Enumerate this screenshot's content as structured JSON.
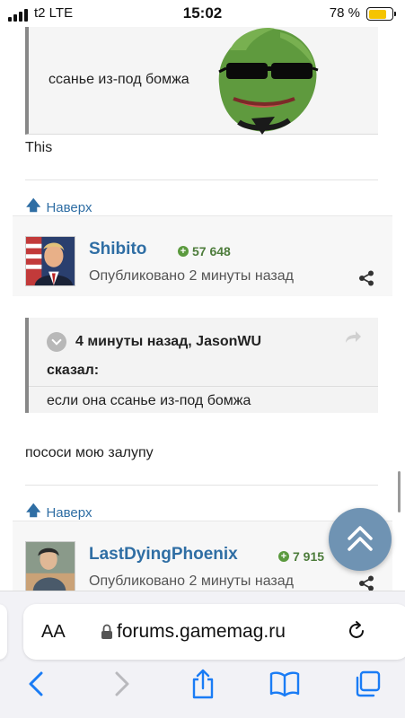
{
  "status_bar": {
    "carrier": "t2  LTE",
    "time": "15:02",
    "battery_percent": "78 %",
    "battery_level": 0.78
  },
  "posts": [
    {
      "quote_text": "ссанье из-под бомжа",
      "reply_text": "This",
      "to_top": "Наверх"
    },
    {
      "username": "Shibito",
      "reputation": "57 648",
      "published": "Опубликовано 2 минуты назад",
      "quote_header": "4 минуты назад, JasonWU",
      "quote_said": "сказал:",
      "quote_body": "если она ссанье из-под бомжа",
      "reply_text": "пососи мою залупу",
      "to_top": "Наверх"
    },
    {
      "username": "LastDyingPhoenix",
      "reputation": "7 915",
      "published": "Опубликовано 2 минуты назад"
    }
  ],
  "browser": {
    "aa_label": "AA",
    "url": "forums.gamemag.ru"
  },
  "icons": {
    "share": "share-icon",
    "scroll_top": "double-chevron-up-icon",
    "back": "chevron-left-icon",
    "forward": "chevron-right-icon",
    "share_sheet": "share-sheet-icon",
    "bookmarks": "book-icon",
    "tabs": "tabs-icon",
    "reload": "reload-icon",
    "lock": "lock-icon"
  },
  "colors": {
    "link": "#2f6ea4",
    "reputation": "#4d7c3b",
    "fab": "#6f93b3",
    "safari_blue": "#1a7cf5"
  }
}
